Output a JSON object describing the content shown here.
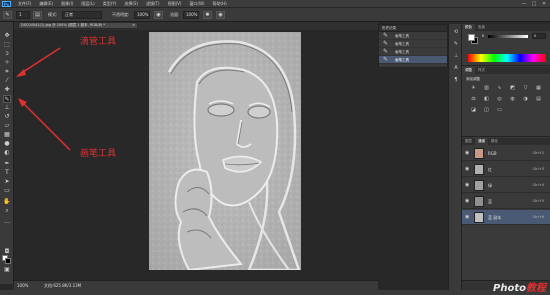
{
  "app": {
    "logo": "Ps"
  },
  "menubar": {
    "items": [
      "文件(F)",
      "编辑(E)",
      "图像(I)",
      "图层(L)",
      "类型(Y)",
      "选择(S)",
      "滤镜(T)",
      "视图(V)",
      "窗口(W)",
      "帮助(H)"
    ]
  },
  "window_controls": [
    "—",
    "□",
    "✕"
  ],
  "optionsbar": {
    "size_value": "1",
    "mode_label": "模式:",
    "mode_value": "正常",
    "opacity_label": "不透明度:",
    "opacity_value": "100%",
    "flow_label": "流量:",
    "flow_value": "100%"
  },
  "document_tab": {
    "title": "DSC04541(1).jpg @ 100% (图层 1 副本, RGB/8) *",
    "close": "×"
  },
  "statusbar": {
    "zoom": "100%",
    "doc_info": "文档:625.8K/3.13M"
  },
  "history": {
    "header": "历史记录",
    "items": [
      "画笔工具",
      "画笔工具",
      "画笔工具",
      "画笔工具"
    ]
  },
  "color_panel": {
    "tabs": [
      "颜色",
      "色板"
    ],
    "slider_label": "K",
    "slider_value": "0"
  },
  "adjustments": {
    "tabs": [
      "调整",
      "样式"
    ],
    "title": "添加调整"
  },
  "layers": {
    "tabs": [
      "图层",
      "通道",
      "路径"
    ],
    "rows": [
      {
        "name": "RGB",
        "shortcut": "Ctrl+2",
        "thumb_color": "#c89888"
      },
      {
        "name": "红",
        "shortcut": "Ctrl+3",
        "thumb_color": "#b0b0b0"
      },
      {
        "name": "绿",
        "shortcut": "Ctrl+4",
        "thumb_color": "#a0a0a0"
      },
      {
        "name": "蓝",
        "shortcut": "Ctrl+5",
        "thumb_color": "#909090"
      },
      {
        "name": "蓝 副本",
        "shortcut": "Ctrl+6",
        "thumb_color": "#c0c0c0"
      }
    ]
  },
  "annotations": {
    "dropper": "滴管工具",
    "brush": "画笔工具"
  },
  "watermark": {
    "text": "Photo",
    "accent": "教程"
  }
}
